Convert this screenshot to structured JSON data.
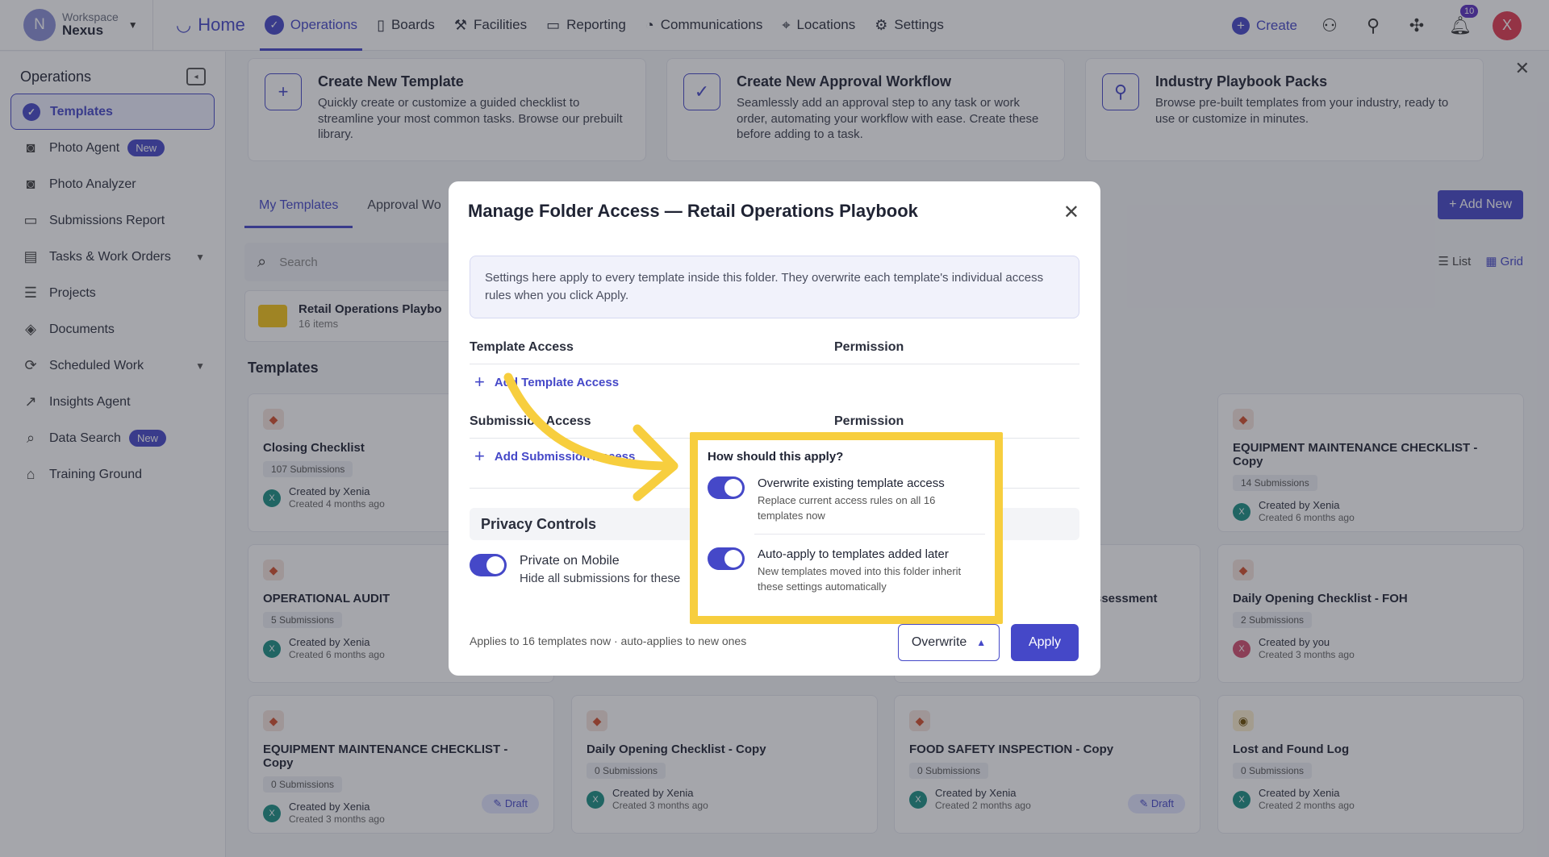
{
  "topnav": {
    "workspace_label": "Workspace",
    "workspace_name": "Nexus",
    "workspace_initial": "N",
    "items": [
      {
        "label": "Home",
        "icon": "home-logo-icon"
      },
      {
        "label": "Operations",
        "icon": "check-circle-icon"
      },
      {
        "label": "Boards",
        "icon": "columns-icon"
      },
      {
        "label": "Facilities",
        "icon": "tools-icon"
      },
      {
        "label": "Reporting",
        "icon": "chart-icon"
      },
      {
        "label": "Communications",
        "icon": "chat-icon"
      },
      {
        "label": "Locations",
        "icon": "location-pin-icon"
      },
      {
        "label": "Settings",
        "icon": "sliders-icon"
      }
    ],
    "create_label": "Create",
    "notification_count": "10",
    "user_initial": "X"
  },
  "sidebar": {
    "title": "Operations",
    "items": [
      {
        "label": "Templates",
        "badge": ""
      },
      {
        "label": "Photo Agent",
        "badge": "New"
      },
      {
        "label": "Photo Analyzer",
        "badge": ""
      },
      {
        "label": "Submissions Report",
        "badge": ""
      },
      {
        "label": "Tasks & Work Orders",
        "badge": ""
      },
      {
        "label": "Projects",
        "badge": ""
      },
      {
        "label": "Documents",
        "badge": ""
      },
      {
        "label": "Scheduled Work",
        "badge": ""
      },
      {
        "label": "Insights Agent",
        "badge": ""
      },
      {
        "label": "Data Search",
        "badge": "New"
      },
      {
        "label": "Training Ground",
        "badge": ""
      }
    ]
  },
  "banners": [
    {
      "title": "Create New Template",
      "desc": "Quickly create or customize a guided checklist to streamline your most common tasks. Browse our prebuilt library."
    },
    {
      "title": "Create New Approval Workflow",
      "desc": "Seamlessly add an approval step to any task or work order, automating your workflow with ease. Create these before adding to a task."
    },
    {
      "title": "Industry Playbook Packs",
      "desc": "Browse pre-built templates from your industry, ready to use or customize in minutes."
    }
  ],
  "tabs": [
    "My Templates",
    "Approval Wo"
  ],
  "add_new_label": "Add New",
  "search_placeholder": "Search",
  "view": {
    "list": "List",
    "grid": "Grid"
  },
  "folder": {
    "name": "Retail Operations Playbo",
    "count": "16 items"
  },
  "templates_title": "Templates",
  "templates": [
    {
      "name": "Closing Checklist",
      "subs": "107 Submissions",
      "by": "Created by Xenia",
      "ago": "Created 4 months ago",
      "draft": ""
    },
    {
      "name": "EQUIPMENT MAINTENANCE CHECKLIST - Copy",
      "subs": "14 Submissions",
      "by": "Created by Xenia",
      "ago": "Created 6 months ago",
      "draft": ""
    },
    {
      "name": "OPERATIONAL AUDIT",
      "subs": "5 Submissions",
      "by": "Created by Xenia",
      "ago": "Created 6 months ago",
      "draft": ""
    },
    {
      "name": "ssessment",
      "subs": "",
      "by": "",
      "ago": "",
      "draft": ""
    },
    {
      "name": "Daily Opening Checklist - FOH",
      "subs": "2 Submissions",
      "by": "Created by you",
      "ago": "Created 3 months ago",
      "draft": ""
    },
    {
      "name": "EQUIPMENT MAINTENANCE CHECKLIST - Copy",
      "subs": "0 Submissions",
      "by": "Created by Xenia",
      "ago": "Created 3 months ago",
      "draft": "Draft"
    },
    {
      "name": "Daily Opening Checklist - Copy",
      "subs": "0 Submissions",
      "by": "Created by Xenia",
      "ago": "Created 3 months ago",
      "draft": ""
    },
    {
      "name": "FOOD SAFETY INSPECTION - Copy",
      "subs": "0 Submissions",
      "by": "Created by Xenia",
      "ago": "Created 2 months ago",
      "draft": "Draft"
    },
    {
      "name": "Lost and Found Log",
      "subs": "0 Submissions",
      "by": "Created by Xenia",
      "ago": "Created 2 months ago",
      "draft": ""
    }
  ],
  "avatar_initial": "X",
  "modal": {
    "title": "Manage Folder Access — Retail Operations Playbook",
    "info": "Settings here apply to every template inside this folder. They overwrite each template's individual access rules when you click Apply.",
    "template_access": "Template Access",
    "permission": "Permission",
    "add_template_access": "Add Template Access",
    "submission_access": "Submission Access",
    "add_submission_access": "Add Submission Access",
    "privacy_title": "Privacy Controls",
    "private_mobile_title": "Private on Mobile",
    "private_mobile_desc": "Hide all submissions for these",
    "footnote": "Applies to 16 templates now · auto-applies to new ones",
    "overwrite_label": "Overwrite",
    "apply_label": "Apply"
  },
  "popover": {
    "title": "How should this apply?",
    "options": [
      {
        "title": "Overwrite existing template access",
        "desc": "Replace current access rules on all 16 templates now",
        "enabled": true
      },
      {
        "title": "Auto-apply to templates added later",
        "desc": "New templates moved into this folder inherit these settings automatically",
        "enabled": true
      }
    ]
  },
  "colors": {
    "accent": "#4548c8",
    "highlight": "#f7ce3e"
  }
}
